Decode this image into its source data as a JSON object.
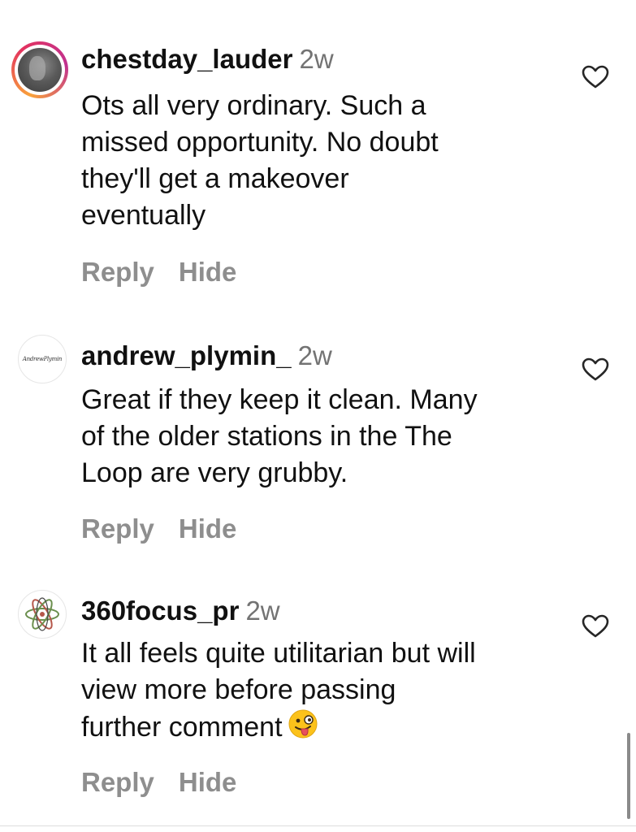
{
  "comments": [
    {
      "username": "chestday_lauder",
      "time": "2w",
      "lines": [
        "Ots all very ordinary.  Such a",
        "missed opportunity.  No doubt",
        "they'll get a makeover",
        "eventually"
      ],
      "reply_label": "Reply",
      "hide_label": "Hide",
      "avatar_icon": "profile-photo-with-story-ring",
      "liked": false
    },
    {
      "username": "andrew_plymin_",
      "time": "2w",
      "avatar_text": "AndrewPlymin",
      "lines": [
        "Great if they keep it clean. Many",
        "of the older stations in the The",
        "Loop are very grubby."
      ],
      "reply_label": "Reply",
      "hide_label": "Hide",
      "avatar_icon": "logo-text-avatar",
      "liked": false
    },
    {
      "username": "360focus_pr",
      "time": "2w",
      "lines": [
        "It all feels quite utilitarian but will",
        "view more before passing",
        "further comment"
      ],
      "emoji": "winking-face-with-tongue",
      "reply_label": "Reply",
      "hide_label": "Hide",
      "avatar_icon": "atom-logo-avatar",
      "liked": false
    }
  ],
  "colors": {
    "text": "#111111",
    "muted": "#737373",
    "action": "#8e8e8e",
    "ring_start": "#f9a23a",
    "ring_mid": "#e3325f"
  }
}
